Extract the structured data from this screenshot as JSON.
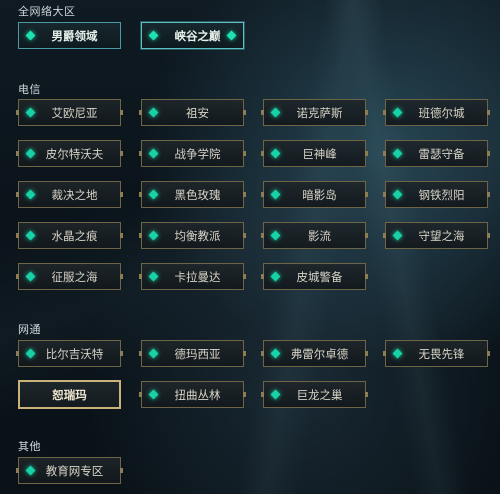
{
  "sections": {
    "all_network": {
      "title": "全网络大区",
      "servers": [
        "男爵领域",
        "峡谷之巅"
      ]
    },
    "telecom": {
      "title": "电信",
      "servers": [
        "艾欧尼亚",
        "祖安",
        "诺克萨斯",
        "班德尔城",
        "皮尔特沃夫",
        "战争学院",
        "巨神峰",
        "雷瑟守备",
        "裁决之地",
        "黑色玫瑰",
        "暗影岛",
        "钢铁烈阳",
        "水晶之痕",
        "均衡教派",
        "影流",
        "守望之海",
        "征服之海",
        "卡拉曼达",
        "皮城警备"
      ]
    },
    "netcom": {
      "title": "网通",
      "servers": [
        "比尔吉沃特",
        "德玛西亚",
        "弗雷尔卓德",
        "无畏先锋",
        "恕瑞玛",
        "扭曲丛林",
        "巨龙之巢"
      ],
      "selected": "恕瑞玛"
    },
    "other": {
      "title": "其他",
      "servers": [
        "教育网专区"
      ]
    }
  },
  "colors": {
    "accent_gem": "#19d1a6",
    "border_gold": "#6e6446",
    "selected_border": "#c9b37a",
    "top_border": "#4a9aa3"
  }
}
